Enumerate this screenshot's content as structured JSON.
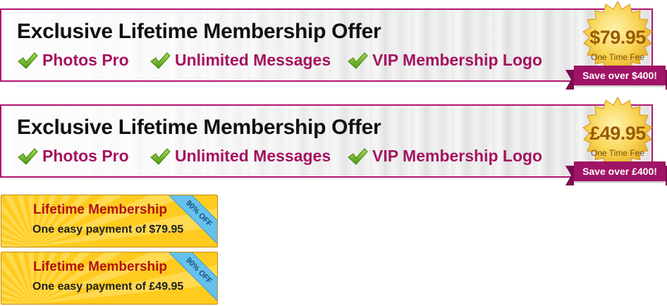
{
  "offers": [
    {
      "title": "Exclusive Lifetime Membership Offer",
      "features": [
        "Photos Pro",
        "Unlimited Messages",
        "VIP Membership Logo"
      ],
      "price": "$79.95",
      "fee_label": "One Time Fee",
      "savings": "Save over $400!"
    },
    {
      "title": "Exclusive Lifetime Membership Offer",
      "features": [
        "Photos Pro",
        "Unlimited Messages",
        "VIP Membership Logo"
      ],
      "price": "£49.95",
      "fee_label": "One Time Fee",
      "savings": "Save over £400!"
    }
  ],
  "cards": [
    {
      "title": "Lifetime Membership",
      "subtitle": "One easy payment of $79.95",
      "corner": "90% OFF"
    },
    {
      "title": "Lifetime Membership",
      "subtitle": "One easy payment of £49.95",
      "corner": "90% OFF"
    }
  ],
  "colors": {
    "brand_magenta": "#a4135f",
    "seal_gold": "#f5c334",
    "card_yellow": "#ffcb1f",
    "corner_blue": "#66c1ee"
  },
  "icons": {
    "feature": "checkmark-icon",
    "seal": "gold-seal-icon"
  }
}
